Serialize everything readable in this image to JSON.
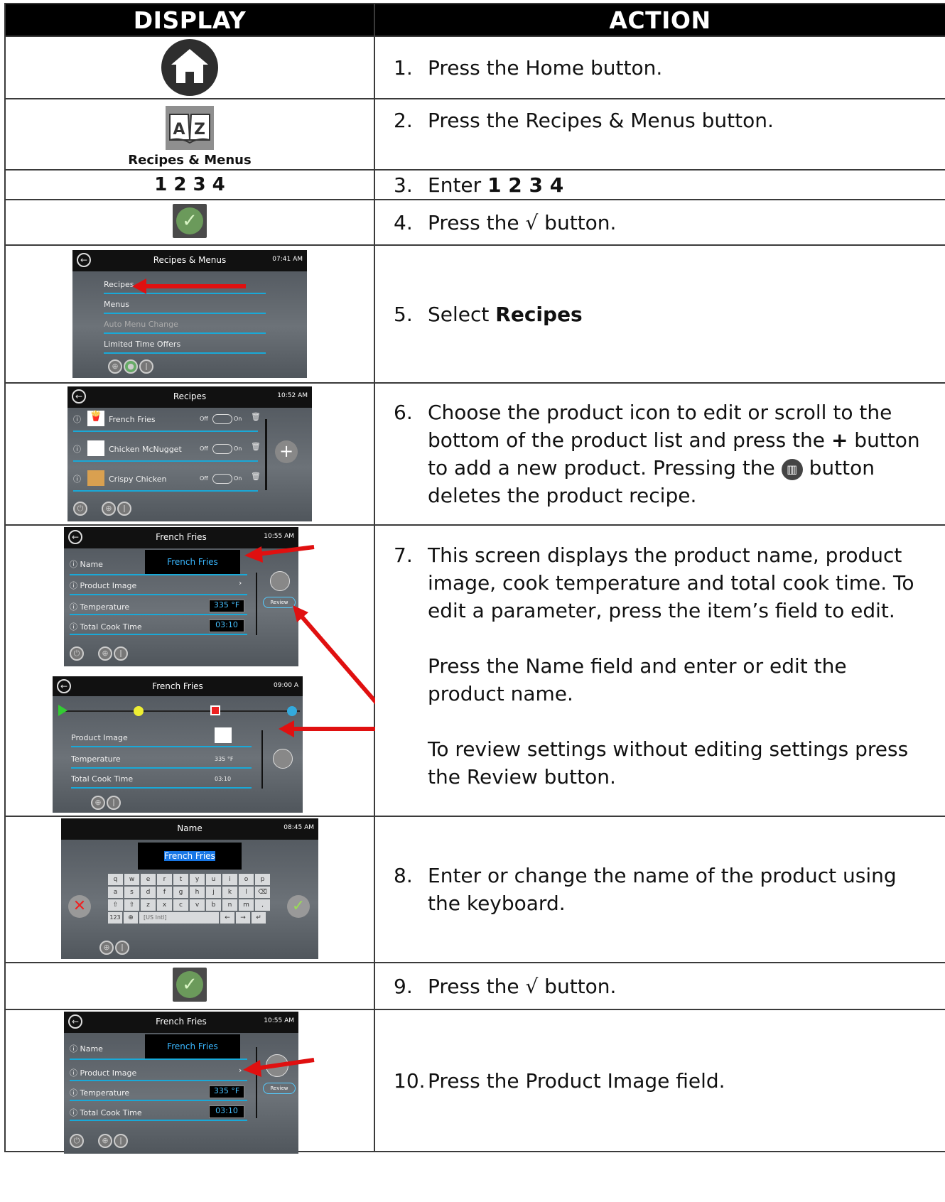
{
  "header": {
    "display": "DISPLAY",
    "action": "ACTION"
  },
  "steps": [
    {
      "num": "1.",
      "text": "Press the Home button."
    },
    {
      "num": "2.",
      "text": "Press the Recipes & Menus button.",
      "display_label": "Recipes & Menus"
    },
    {
      "num": "3.",
      "text": "Enter ",
      "bold": "1 2 3 4",
      "display_label": "1 2 3 4"
    },
    {
      "num": "4.",
      "text": "Press the √ button."
    },
    {
      "num": "5.",
      "text": "Select ",
      "bold": "Recipes"
    },
    {
      "num": "6.",
      "text_a": "Choose the product icon to edit or scroll to the bottom of the product list and press the ",
      "bold": "+",
      "text_b": " button to add a new product.  Pressing the ",
      "text_c": " button deletes the product recipe."
    },
    {
      "num": "7.",
      "p1": "This screen displays the product name, product image, cook temperature and total cook time. To edit a parameter, press the item’s field to edit.",
      "p2": "Press the Name field and enter or edit the product name.",
      "p3": "To review settings without editing settings press the Review button."
    },
    {
      "num": "8.",
      "text": "Enter or change the name of the product using the keyboard."
    },
    {
      "num": "9.",
      "text": "Press the √ button."
    },
    {
      "num": "10.",
      "text": "Press the Product Image field."
    }
  ],
  "screens": {
    "recipes_menus": {
      "title": "Recipes & Menus",
      "time": "07:41 AM",
      "items": [
        "Recipes",
        "Menus",
        "Auto Menu Change",
        "Limited Time Offers"
      ]
    },
    "recipes": {
      "title": "Recipes",
      "time": "10:52 AM",
      "items": [
        "French Fries",
        "Chicken McNugget",
        "Crispy Chicken"
      ],
      "toggle_off": "Off",
      "toggle_on": "On"
    },
    "edit": {
      "title": "French Fries",
      "time": "10:55 AM",
      "name_label": "Name",
      "name_value": "French Fries",
      "image_label": "Product Image",
      "temp_label": "Temperature",
      "temp_value": "335 °F",
      "time_label": "Total Cook Time",
      "time_value": "03:10",
      "review": "Review"
    },
    "review": {
      "title": "French Fries",
      "time": "09:00 A",
      "image_label": "Product Image",
      "temp_label": "Temperature",
      "temp_value": "335 °F",
      "time_label": "Total Cook Time",
      "time_value": "03:10"
    },
    "keyboard": {
      "title": "Name",
      "time": "08:45 AM",
      "field": "French Fries",
      "row1": [
        "q",
        "w",
        "e",
        "r",
        "t",
        "y",
        "u",
        "i",
        "o",
        "p"
      ],
      "row2": [
        "a",
        "s",
        "d",
        "f",
        "g",
        "h",
        "j",
        "k",
        "l",
        "⌫"
      ],
      "row3": [
        "⇧",
        "⇧",
        "z",
        "x",
        "c",
        "v",
        "b",
        "n",
        "m",
        ","
      ],
      "row4_left": "123",
      "row4_space": "[US Intl]"
    }
  },
  "colors": {
    "header_bg": "#000000",
    "arrow_red": "#e01010",
    "accent_blue": "#19a9d8",
    "check_green": "#6b9a5b"
  }
}
